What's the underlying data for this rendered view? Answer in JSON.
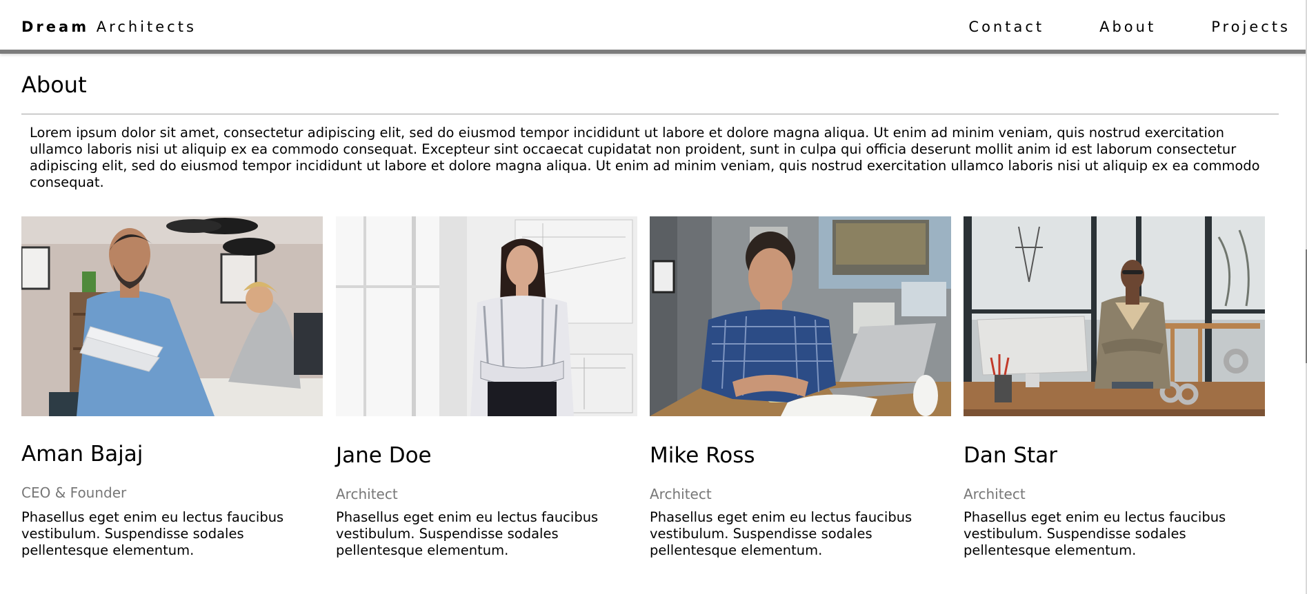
{
  "nav": {
    "brand_bold": "Dream",
    "brand_rest": "Architects",
    "links": [
      {
        "label": "Contact"
      },
      {
        "label": "About"
      },
      {
        "label": "Projects"
      }
    ]
  },
  "about": {
    "title": "About",
    "intro": "Lorem ipsum dolor sit amet, consectetur adipiscing elit, sed do eiusmod tempor incididunt ut labore et dolore magna aliqua. Ut enim ad minim veniam, quis nostrud exercitation ullamco laboris nisi ut aliquip ex ea commodo consequat. Excepteur sint occaecat cupidatat non proident, sunt in culpa qui officia deserunt mollit anim id est laborum consectetur adipiscing elit, sed do eiusmod tempor incididunt ut labore et dolore magna aliqua. Ut enim ad minim veniam, quis nostrud exercitation ullamco laboris nisi ut aliquip ex ea commodo consequat."
  },
  "team": [
    {
      "name": "Aman Bajaj",
      "role": "CEO & Founder",
      "bio": "Phasellus eget enim eu lectus faucibus vestibulum. Suspendisse sodales pellentesque elementum."
    },
    {
      "name": "Jane Doe",
      "role": "Architect",
      "bio": "Phasellus eget enim eu lectus faucibus vestibulum. Suspendisse sodales pellentesque elementum."
    },
    {
      "name": "Mike Ross",
      "role": "Architect",
      "bio": "Phasellus eget enim eu lectus faucibus vestibulum. Suspendisse sodales pellentesque elementum."
    },
    {
      "name": "Dan Star",
      "role": "Architect",
      "bio": "Phasellus eget enim eu lectus faucibus vestibulum. Suspendisse sodales pellentesque elementum."
    }
  ]
}
